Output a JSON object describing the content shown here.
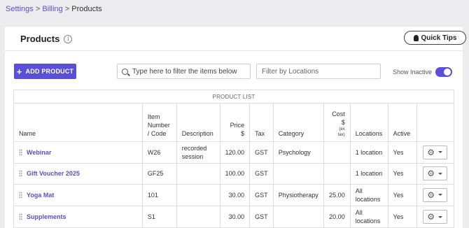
{
  "breadcrumb": {
    "settings": "Settings",
    "billing": "Billing",
    "sep": ">",
    "current": "Products"
  },
  "panel": {
    "title": "Products",
    "info_glyph": "i",
    "quick_tips": "Quick Tips"
  },
  "toolbar": {
    "add_label": "ADD PRODUCT",
    "search_placeholder": "Type here to filter the items below",
    "location_placeholder": "Filter by Locations",
    "show_inactive": "Show Inactive",
    "show_inactive_on": true
  },
  "table": {
    "caption": "PRODUCT LIST",
    "headers": {
      "name": "Name",
      "code_1": "Item",
      "code_2": "Number",
      "code_3": "/ Code",
      "description": "Description",
      "price_1": "Price",
      "price_2": "$",
      "tax": "Tax",
      "category": "Category",
      "cost_1": "Cost",
      "cost_2": "$",
      "cost_3": "(ex",
      "cost_4": "tax)",
      "locations": "Locations",
      "active": "Active"
    },
    "rows": [
      {
        "name": "Webinar",
        "code": "W26",
        "description_1": "recorded",
        "description_2": "session",
        "price": "120.00",
        "tax": "GST",
        "category": "Psychology",
        "cost": "",
        "locations_1": "1 location",
        "locations_2": "",
        "active": "Yes"
      },
      {
        "name": "Gift Voucher 2025",
        "code": "GF25",
        "description_1": "",
        "description_2": "",
        "price": "100.00",
        "tax": "GST",
        "category": "",
        "cost": "",
        "locations_1": "1 location",
        "locations_2": "",
        "active": "Yes"
      },
      {
        "name": "Yoga Mat",
        "code": "101",
        "description_1": "",
        "description_2": "",
        "price": "30.00",
        "tax": "GST",
        "category": "Physiotherapy",
        "cost": "25.00",
        "locations_1": "All",
        "locations_2": "locations",
        "active": "Yes"
      },
      {
        "name": "Supplements",
        "code": "S1",
        "description_1": "",
        "description_2": "",
        "price": "30.00",
        "tax": "GST",
        "category": "",
        "cost": "20.00",
        "locations_1": "All",
        "locations_2": "locations",
        "active": "Yes"
      }
    ]
  },
  "icons": {
    "gear": "gear-icon",
    "caret": "chevron-down-icon",
    "drag": "drag-handle-icon",
    "search": "search-icon",
    "bulb": "lightbulb-icon",
    "plus": "plus-icon"
  },
  "colors": {
    "accent": "#5a4fd8",
    "link": "#5a4fcf"
  }
}
